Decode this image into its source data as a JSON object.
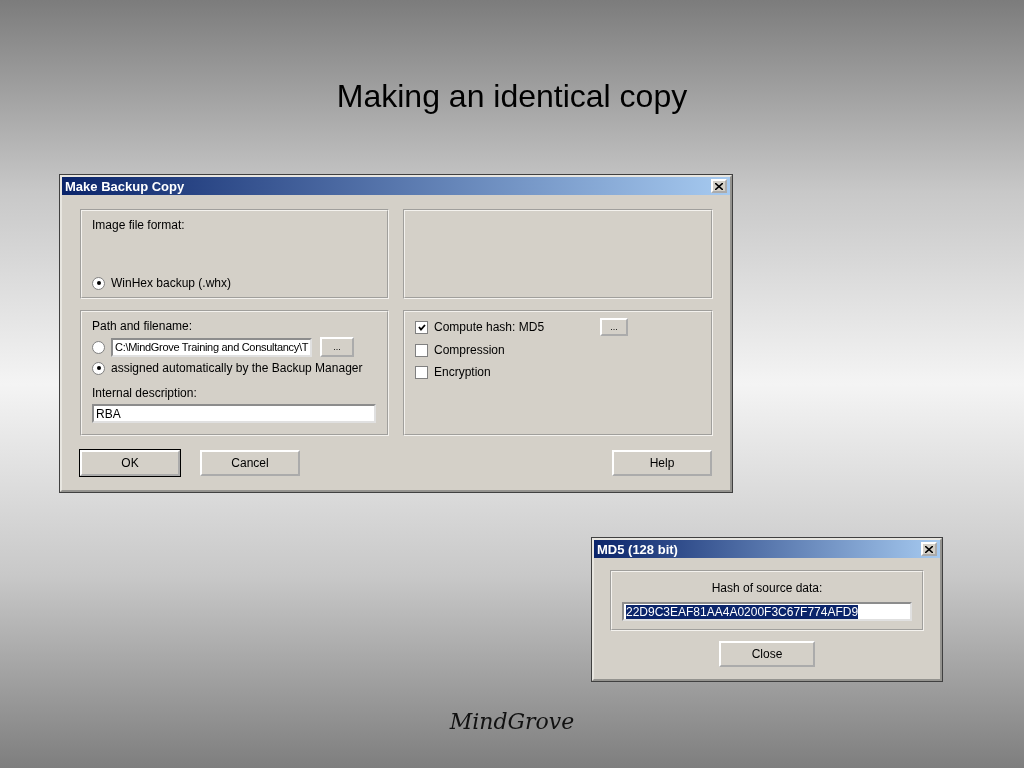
{
  "slide": {
    "title": "Making an identical copy",
    "footer_logo": "MindGrove"
  },
  "backup_dialog": {
    "title": "Make Backup Copy",
    "format_group": {
      "label": "Image file format:",
      "options": [
        {
          "label": "WinHex backup (.whx)",
          "selected": true
        }
      ]
    },
    "path_group": {
      "label": "Path and filename:",
      "path_option": {
        "selected": false,
        "value": "C:\\MindGrove Training and Consultancy\\T",
        "browse": "..."
      },
      "auto_option": {
        "label": "assigned automatically by the Backup Manager",
        "selected": true
      },
      "description_label": "Internal description:",
      "description_value": "RBA"
    },
    "options": [
      {
        "label": "Compute hash: MD5",
        "checked": true,
        "settings": "..."
      },
      {
        "label": "Compression",
        "checked": false
      },
      {
        "label": "Encryption",
        "checked": false
      }
    ],
    "left_buttons": [
      {
        "label": "OK",
        "default": true
      },
      {
        "label": "Cancel",
        "default": false
      }
    ],
    "right_buttons": [
      {
        "label": "Help",
        "default": false
      }
    ]
  },
  "hash_dialog": {
    "title": "MD5 (128 bit)",
    "label": "Hash of source data:",
    "value": "22D9C3EAF81AA4A0200F3C67F774AFD9",
    "value_selected": true,
    "button": "Close"
  }
}
